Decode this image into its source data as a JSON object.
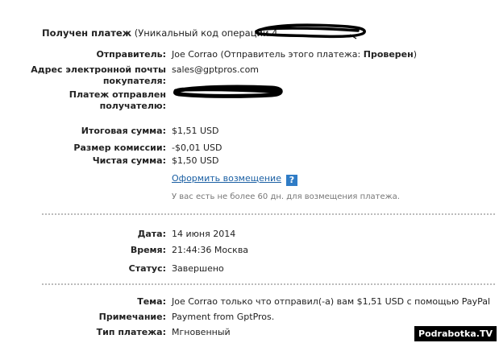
{
  "header": {
    "title": "Получен платеж",
    "subtitle": "(Уникальный код операции 4"
  },
  "details": {
    "sender_label": "Отправитель:",
    "sender_name": "Joe Corrao (Отправитель этого платежа:",
    "sender_status": "Проверен",
    "sender_close": ")",
    "email_label_line1": "Адрес электронной почты",
    "email_label_line2": "покупателя:",
    "email_value": "sales@gptpros.com",
    "recipient_label_line1": "Платеж отправлен",
    "recipient_label_line2": "получателю:"
  },
  "amounts": {
    "total_label": "Итоговая сумма:",
    "total_value": "$1,51 USD",
    "fee_label": "Размер комиссии:",
    "fee_value": "-$0,01 USD",
    "net_label": "Чистая сумма:",
    "net_value": "$1,50 USD",
    "refund_link": "Оформить возмещение",
    "help_icon": "?",
    "refund_note": "У вас есть не более 60 дн. для возмещения платежа."
  },
  "status": {
    "date_label": "Дата:",
    "date_value": "14 июня 2014",
    "time_label": "Время:",
    "time_value": "21:44:36 Москва",
    "status_label": "Статус:",
    "status_value": "Завершено"
  },
  "info": {
    "subject_label": "Тема:",
    "subject_value": "Joe Corrao только что отправил(-а) вам $1,51 USD с помощью PayPal",
    "note_label": "Примечание:",
    "note_value": "Payment from GptPros.",
    "type_label": "Тип платежа:",
    "type_value": "Мгновенный"
  },
  "watermark": "Podrabotka.TV",
  "colors": {
    "link": "#1a5fa3",
    "help_icon_bg": "#2f7cc6",
    "note_text": "#777777",
    "divider": "#bbbbbb"
  }
}
